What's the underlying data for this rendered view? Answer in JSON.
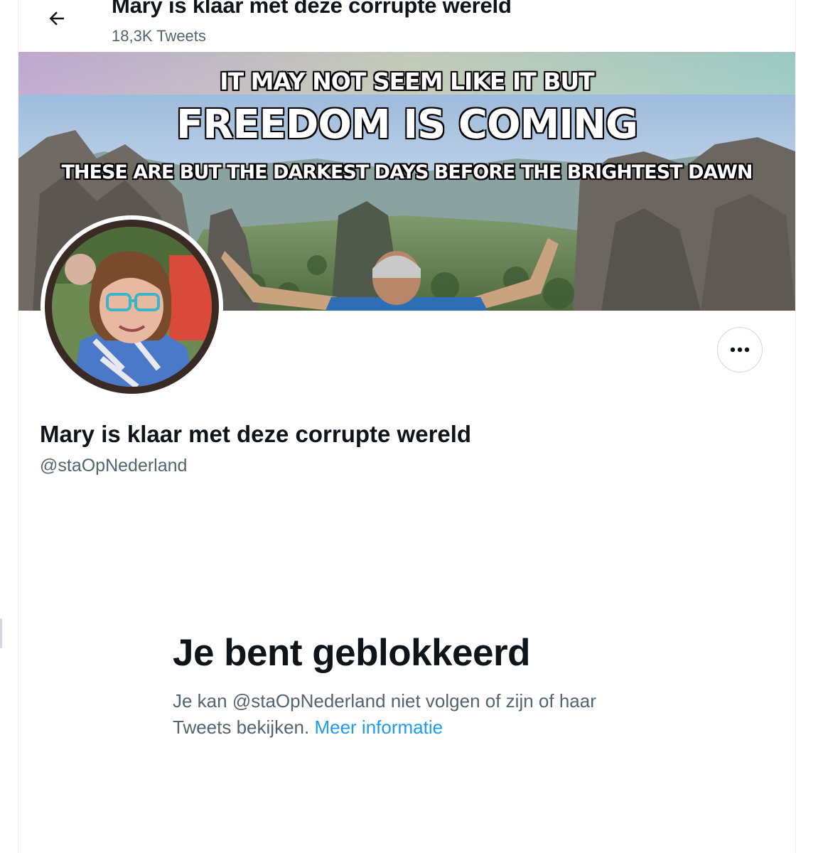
{
  "header": {
    "back_icon": "arrow-left-icon",
    "title": "Mary is klaar met deze corrupte wereld",
    "tweet_count": "18,3K Tweets"
  },
  "banner": {
    "line1": "IT MAY NOT SEEM LIKE IT BUT",
    "line2": "FREEDOM IS COMING",
    "line3": "THESE ARE BUT THE DARKEST DAYS BEFORE THE BRIGHTEST DAWN"
  },
  "profile": {
    "name": "Mary is klaar met deze corrupte wereld",
    "handle": "@staOpNederland",
    "more_icon": "more-dots-icon"
  },
  "blocked": {
    "title": "Je bent geblokkeerd",
    "message": "Je kan @staOpNederland niet volgen of zijn of haar Tweets bekijken.",
    "link": "Meer informatie"
  },
  "colors": {
    "text_primary": "#0f1419",
    "text_secondary": "#536471",
    "link": "#1d9bf0",
    "border": "#cfd9de"
  }
}
